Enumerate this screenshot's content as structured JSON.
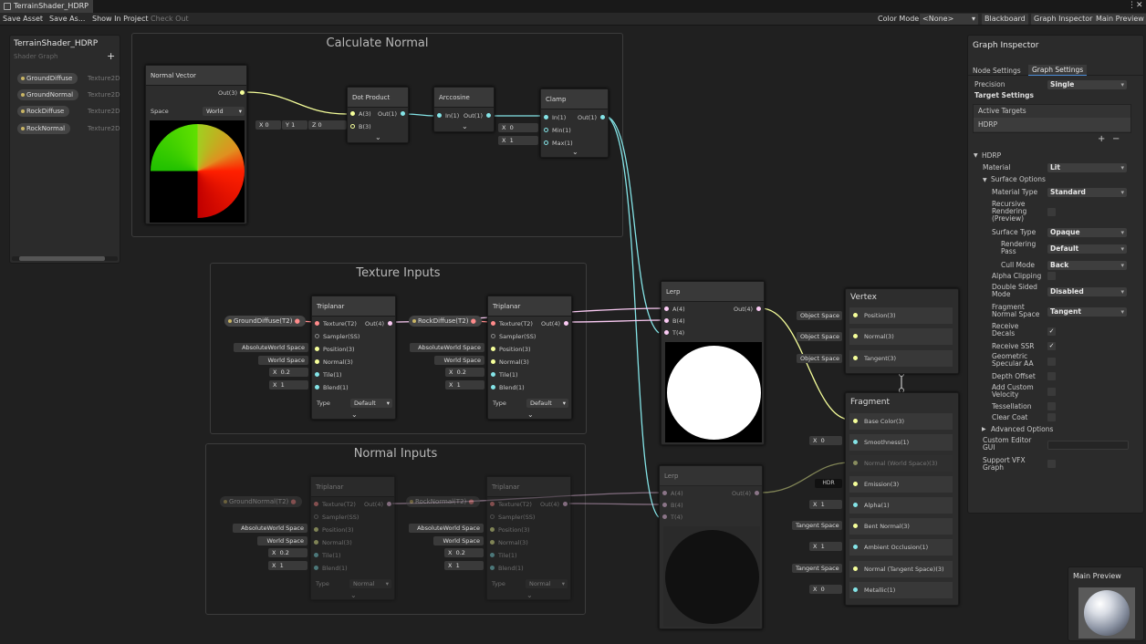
{
  "window": {
    "tab_title": "TerrainShader_HDRP",
    "menu_icon": "kebab-menu-icon",
    "close_icon": "close-icon"
  },
  "toolbar": {
    "save_asset": "Save Asset",
    "save_as": "Save As...",
    "show_in_project": "Show In Project",
    "check_out": "Check Out",
    "color_mode_label": "Color Mode",
    "color_mode_value": "<None>",
    "blackboard": "Blackboard",
    "graph_inspector": "Graph Inspector",
    "main_preview": "Main Preview"
  },
  "blackboard": {
    "title": "TerrainShader_HDRP",
    "subtitle": "Shader Graph",
    "add": "+",
    "properties": [
      {
        "name": "GroundDiffuse",
        "type": "Texture2D"
      },
      {
        "name": "GroundNormal",
        "type": "Texture2D"
      },
      {
        "name": "RockDiffuse",
        "type": "Texture2D"
      },
      {
        "name": "RockNormal",
        "type": "Texture2D"
      }
    ]
  },
  "groups": {
    "calc": "Calculate Normal",
    "tex": "Texture Inputs",
    "norm": "Normal Inputs"
  },
  "normal_vector": {
    "title": "Normal Vector",
    "out": "Out(3)",
    "space_label": "Space",
    "space_value": "World"
  },
  "dot_product": {
    "title": "Dot Product",
    "a": "A(3)",
    "b": "B(3)",
    "out": "Out(1)",
    "bx": "X",
    "bxv": "0",
    "by": "Y",
    "byv": "1",
    "bz": "Z",
    "bzv": "0"
  },
  "arccosine": {
    "title": "Arccosine",
    "in": "In(1)",
    "out": "Out(1)"
  },
  "clamp": {
    "title": "Clamp",
    "in": "In(1)",
    "min": "Min(1)",
    "max": "Max(1)",
    "out": "Out(1)",
    "minx": "X",
    "minv": "0",
    "maxx": "X",
    "maxv": "1"
  },
  "tri1": {
    "title": "Triplanar",
    "texture": "Texture(T2)",
    "sampler": "Sampler(SS)",
    "position": "Position(3)",
    "normal": "Normal(3)",
    "tile": "Tile(1)",
    "blend": "Blend(1)",
    "out": "Out(4)",
    "type_label": "Type",
    "type_value": "Default",
    "prop": "GroundDiffuse(T2)",
    "pos_in": "AbsoluteWorld Space",
    "norm_in": "World Space",
    "tile_x": "X",
    "tile_v": "0.2",
    "blend_x": "X",
    "blend_v": "1"
  },
  "tri2": {
    "title": "Triplanar",
    "texture": "Texture(T2)",
    "sampler": "Sampler(SS)",
    "position": "Position(3)",
    "normal": "Normal(3)",
    "tile": "Tile(1)",
    "blend": "Blend(1)",
    "out": "Out(4)",
    "type_label": "Type",
    "type_value": "Default",
    "prop": "RockDiffuse(T2)",
    "pos_in": "AbsoluteWorld Space",
    "norm_in": "World Space",
    "tile_x": "X",
    "tile_v": "0.2",
    "blend_x": "X",
    "blend_v": "1"
  },
  "tri3": {
    "title": "Triplanar",
    "texture": "Texture(T2)",
    "sampler": "Sampler(SS)",
    "position": "Position(3)",
    "normal": "Normal(3)",
    "tile": "Tile(1)",
    "blend": "Blend(1)",
    "out": "Out(4)",
    "type_label": "Type",
    "type_value": "Normal",
    "prop": "GroundNormal(T2)",
    "pos_in": "AbsoluteWorld Space",
    "norm_in": "World Space",
    "tile_x": "X",
    "tile_v": "0.2",
    "blend_x": "X",
    "blend_v": "1"
  },
  "tri4": {
    "title": "Triplanar",
    "texture": "Texture(T2)",
    "sampler": "Sampler(SS)",
    "position": "Position(3)",
    "normal": "Normal(3)",
    "tile": "Tile(1)",
    "blend": "Blend(1)",
    "out": "Out(4)",
    "type_label": "Type",
    "type_value": "Normal",
    "prop": "RockNormal(T2)",
    "pos_in": "AbsoluteWorld Space",
    "norm_in": "World Space",
    "tile_x": "X",
    "tile_v": "0.2",
    "blend_x": "X",
    "blend_v": "1"
  },
  "lerp1": {
    "title": "Lerp",
    "a": "A(4)",
    "b": "B(4)",
    "t": "T(4)",
    "out": "Out(4)"
  },
  "lerp2": {
    "title": "Lerp",
    "a": "A(4)",
    "b": "B(4)",
    "t": "T(4)",
    "out": "Out(4)"
  },
  "vertex": {
    "title": "Vertex",
    "position": "Position(3)",
    "normal": "Normal(3)",
    "tangent": "Tangent(3)",
    "in": "Object Space"
  },
  "fragment": {
    "title": "Fragment",
    "base_color": "Base Color(3)",
    "smoothness": "Smoothness(1)",
    "smooth_x": "X",
    "smooth_v": "0",
    "normal_ws": "Normal (World Space)(3)",
    "emission": "Emission(3)",
    "emission_in": "HDR",
    "alpha": "Alpha(1)",
    "alpha_x": "X",
    "alpha_v": "1",
    "bent_normal": "Bent Normal(3)",
    "bent_in": "Tangent Space",
    "ao": "Ambient Occlusion(1)",
    "ao_x": "X",
    "ao_v": "1",
    "normal_ts": "Normal (Tangent Space)(3)",
    "normal_ts_in": "Tangent Space",
    "metallic": "Metallic(1)",
    "metallic_x": "X",
    "metallic_v": "0"
  },
  "inspector": {
    "title": "Graph Inspector",
    "tab_node": "Node Settings",
    "tab_graph": "Graph Settings",
    "precision_label": "Precision",
    "precision_value": "Single",
    "target_settings": "Target Settings",
    "active_targets": "Active Targets",
    "target_hdrp": "HDRP",
    "add": "+",
    "remove": "−",
    "hdrp": "HDRP",
    "material_label": "Material",
    "material_value": "Lit",
    "surface_options": "Surface Options",
    "material_type_label": "Material Type",
    "material_type_value": "Standard",
    "recursive": "Recursive Rendering (Preview)",
    "surface_type_label": "Surface Type",
    "surface_type_value": "Opaque",
    "rendering_pass_label": "Rendering Pass",
    "rendering_pass_value": "Default",
    "cull_mode_label": "Cull Mode",
    "cull_mode_value": "Back",
    "alpha_clipping": "Alpha Clipping",
    "double_sided_label": "Double Sided Mode",
    "double_sided_value": "Disabled",
    "fragment_normal_label": "Fragment Normal Space",
    "fragment_normal_value": "Tangent",
    "receive_decals": "Receive Decals",
    "receive_ssr": "Receive SSR",
    "geometric_aa": "Geometric Specular AA",
    "depth_offset": "Depth Offset",
    "add_velocity": "Add Custom Velocity",
    "tessellation": "Tessellation",
    "clear_coat": "Clear Coat",
    "advanced": "Advanced Options",
    "custom_gui": "Custom Editor GUI",
    "support_vfx": "Support VFX Graph",
    "check": "✓"
  },
  "main_preview": {
    "title": "Main Preview"
  },
  "colors": {
    "vector3": "#f6ff9a",
    "vector1": "#84e4e7",
    "vector4": "#fbcbf4",
    "texture": "#ff8b8b",
    "port_fill": "#c8c8c8"
  }
}
